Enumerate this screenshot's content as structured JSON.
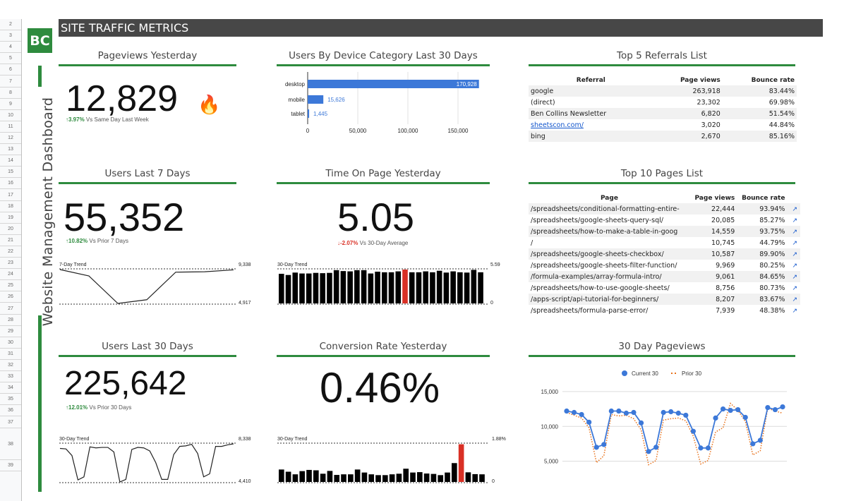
{
  "row_numbers": [
    "2",
    "3",
    "4",
    "5",
    "6",
    "7",
    "8",
    "9",
    "10",
    "11",
    "12",
    "13",
    "14",
    "15",
    "16",
    "17",
    "18",
    "19",
    "20",
    "21",
    "22",
    "23",
    "24",
    "25",
    "26",
    "27",
    "28",
    "29",
    "30",
    "31",
    "32",
    "33",
    "34",
    "35",
    "36",
    "37",
    "38",
    "39"
  ],
  "logo": "BC",
  "sidebar_title": "Website Management Dashboard",
  "header": {
    "title": "SITE TRAFFIC METRICS"
  },
  "colors": {
    "accent": "#2e8b3e",
    "up": "#2e8b3e",
    "down": "#d93025",
    "bar": "#000000",
    "highlight": "#d93025",
    "series_current": "#3c78d8",
    "series_prior": "#e8711a"
  },
  "panels": {
    "pageviews_yesterday": {
      "title": "Pageviews Yesterday",
      "value": "12,829",
      "delta": "↑3.97%",
      "delta_label": "Vs Same Day Last Week",
      "icon": "fire-icon"
    },
    "users_7": {
      "title": "Users Last 7 Days",
      "value": "55,352",
      "delta": "↑10.82%",
      "delta_label": "Vs Prior 7 Days",
      "trend_label": "7-Day Trend",
      "max": "9,338",
      "min": "4,917",
      "trend": [
        9338,
        8500,
        4917,
        5400,
        9000,
        9050,
        9300
      ]
    },
    "users_30": {
      "title": "Users Last 30 Days",
      "value": "225,642",
      "delta": "↑12.01%",
      "delta_label": "Vs Prior 30 Days",
      "trend_label": "30-Day Trend",
      "max": "8,338",
      "min": "4,410",
      "trend": [
        7800,
        7750,
        7100,
        4700,
        5000,
        7950,
        7850,
        7900,
        7900,
        7450,
        4500,
        4750,
        7700,
        7900,
        7850,
        7550,
        6400,
        4750,
        4750,
        7200,
        8000,
        8050,
        8200,
        7300,
        5000,
        5300,
        8000,
        8000,
        8150,
        8250
      ]
    },
    "time_on_page": {
      "title": "Time On Page Yesterday",
      "value": "5.05",
      "delta": "↓-2.07%",
      "delta_label": "Vs 30-Day Average",
      "trend_label": "30-Day Trend",
      "max": "5.59",
      "min": "0",
      "highlight_index": 18,
      "trend": [
        4.9,
        4.7,
        5.1,
        4.95,
        4.95,
        5.05,
        5.0,
        5.05,
        5.5,
        5.35,
        5.3,
        5.5,
        5.5,
        4.95,
        5.25,
        5.15,
        5.15,
        5.3,
        5.6,
        5.15,
        5.15,
        5.3,
        5.15,
        5.4,
        5.1,
        5.3,
        5.15,
        5.1,
        5.55,
        5.15
      ]
    },
    "conversion_rate": {
      "title": "Conversion Rate Yesterday",
      "value": "0.46%",
      "trend_label": "30-Day Trend",
      "max": "1.88%",
      "min": "0",
      "highlight_index": 26,
      "trend": [
        0.62,
        0.51,
        0.38,
        0.54,
        0.6,
        0.58,
        0.41,
        0.55,
        0.35,
        0.38,
        0.38,
        0.62,
        0.47,
        0.38,
        0.34,
        0.34,
        0.38,
        0.41,
        0.66,
        0.47,
        0.49,
        0.42,
        0.4,
        0.34,
        0.47,
        0.94,
        1.88,
        0.48,
        0.39,
        0.38
      ]
    },
    "device": {
      "title": "Users By Device Category Last 30 Days"
    },
    "referrals": {
      "title": "Top 5 Referrals List",
      "columns": [
        "Referral",
        "Page views",
        "Bounce rate"
      ],
      "rows": [
        {
          "name": "google",
          "views": "263,918",
          "bounce": "83.44%",
          "link": false
        },
        {
          "name": "(direct)",
          "views": "23,302",
          "bounce": "69.98%",
          "link": false
        },
        {
          "name": "Ben Collins Newsletter",
          "views": "6,820",
          "bounce": "51.54%",
          "link": false
        },
        {
          "name": "sheetscon.com/",
          "views": "3,020",
          "bounce": "44.84%",
          "link": true
        },
        {
          "name": "bing",
          "views": "2,670",
          "bounce": "85.16%",
          "link": false
        }
      ]
    },
    "pages": {
      "title": "Top 10 Pages List",
      "columns": [
        "Page",
        "Page views",
        "Bounce rate"
      ],
      "ext_icon": "↗",
      "rows": [
        {
          "name": "/spreadsheets/conditional-formatting-entire-",
          "views": "22,444",
          "bounce": "93.94%"
        },
        {
          "name": "/spreadsheets/google-sheets-query-sql/",
          "views": "20,085",
          "bounce": "85.27%"
        },
        {
          "name": "/spreadsheets/how-to-make-a-table-in-goog",
          "views": "14,559",
          "bounce": "93.75%"
        },
        {
          "name": "/",
          "views": "10,745",
          "bounce": "44.79%"
        },
        {
          "name": "/spreadsheets/google-sheets-checkbox/",
          "views": "10,587",
          "bounce": "89.90%"
        },
        {
          "name": "/spreadsheets/google-sheets-filter-function/",
          "views": "9,969",
          "bounce": "80.25%"
        },
        {
          "name": "/formula-examples/array-formula-intro/",
          "views": "9,061",
          "bounce": "84.65%"
        },
        {
          "name": "/spreadsheets/how-to-use-google-sheets/",
          "views": "8,756",
          "bounce": "80.73%"
        },
        {
          "name": "/apps-script/api-tutorial-for-beginners/",
          "views": "8,207",
          "bounce": "83.67%"
        },
        {
          "name": "/spreadsheets/formula-parse-error/",
          "views": "7,939",
          "bounce": "48.38%"
        }
      ]
    },
    "pageviews_30": {
      "title": "30 Day Pageviews"
    }
  },
  "chart_data": [
    {
      "type": "bar",
      "orientation": "horizontal",
      "title": "Users By Device Category Last 30 Days",
      "categories": [
        "desktop",
        "mobile",
        "tablet"
      ],
      "values": [
        170928,
        15626,
        1445
      ],
      "value_labels": [
        "170,928",
        "15,626",
        "1,445"
      ],
      "xlim": [
        0,
        200000
      ],
      "xticks": [
        0,
        50000,
        100000,
        150000
      ],
      "xtick_labels": [
        "0",
        "50,000",
        "100,000",
        "150,000"
      ],
      "grid": true
    },
    {
      "type": "line",
      "title": "30 Day Pageviews",
      "legend": "top",
      "ylim": [
        0,
        16000
      ],
      "yticks": [
        5000,
        10000,
        15000
      ],
      "ytick_labels": [
        "5,000",
        "10,000",
        "15,000"
      ],
      "grid": true,
      "series": [
        {
          "name": "Current 30",
          "style": "solid-markers",
          "values": [
            12200,
            12000,
            11700,
            10600,
            7000,
            7400,
            12200,
            12200,
            11900,
            12000,
            10500,
            6400,
            7000,
            12000,
            12100,
            11900,
            11600,
            9300,
            6900,
            6900,
            11200,
            12500,
            12300,
            12400,
            11300,
            7500,
            8000,
            12700,
            12400,
            12800
          ]
        },
        {
          "name": "Prior 30",
          "style": "dotted",
          "values": [
            12000,
            11600,
            11200,
            9800,
            4800,
            5800,
            11700,
            11500,
            11600,
            11100,
            9500,
            4500,
            5100,
            10900,
            11100,
            11200,
            10800,
            8600,
            4600,
            5100,
            9200,
            9800,
            13300,
            12300,
            10700,
            5900,
            6500,
            12600,
            12200,
            11900
          ]
        }
      ]
    }
  ]
}
